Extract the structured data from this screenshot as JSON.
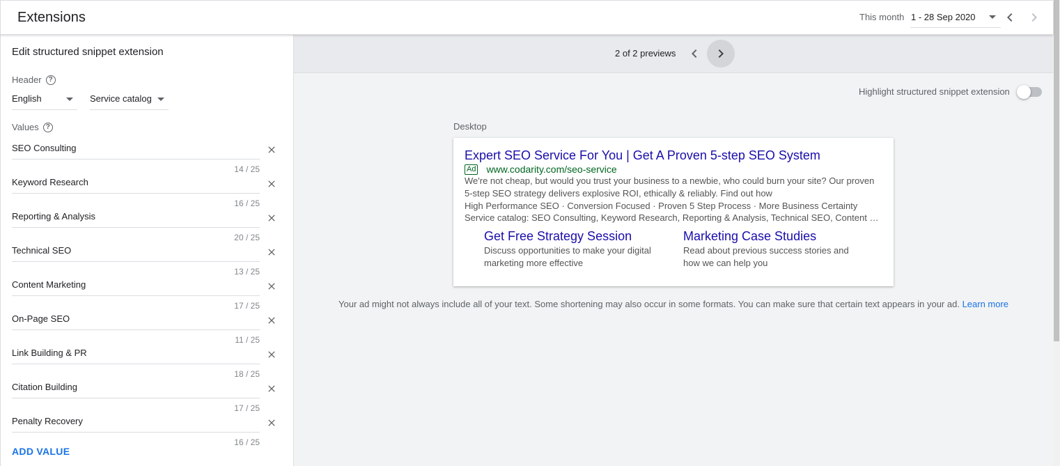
{
  "header": {
    "title": "Extensions",
    "range_label": "This month",
    "range_value": "1 - 28 Sep 2020"
  },
  "editor": {
    "heading": "Edit structured snippet extension",
    "header_label": "Header",
    "language": "English",
    "header_type": "Service catalog",
    "values_label": "Values",
    "values": [
      {
        "text": "SEO Consulting",
        "count": "14 / 25"
      },
      {
        "text": "Keyword Research",
        "count": "16 / 25"
      },
      {
        "text": "Reporting & Analysis",
        "count": "20 / 25"
      },
      {
        "text": "Technical SEO",
        "count": "13 / 25"
      },
      {
        "text": "Content Marketing",
        "count": "17 / 25"
      },
      {
        "text": "On-Page SEO",
        "count": "11 / 25"
      },
      {
        "text": "Link Building & PR",
        "count": "18 / 25"
      },
      {
        "text": "Citation Building",
        "count": "17 / 25"
      },
      {
        "text": "Penalty Recovery",
        "count": "16 / 25"
      }
    ],
    "add_value": "ADD VALUE"
  },
  "preview": {
    "count": "2 of 2 previews",
    "highlight_label": "Highlight structured snippet extension",
    "highlight_on": false,
    "device_label": "Desktop",
    "ad": {
      "headline": "Expert SEO Service For You | Get A Proven 5-step SEO System",
      "badge": "Ad",
      "url": "www.codarity.com/seo-service",
      "description": "We're not cheap, but would you trust your business to a newbie, who could burn your site? Our proven 5-step SEO strategy delivers explosive ROI, ethically & reliably. Find out how",
      "callouts": "High Performance SEO · Conversion Focused · Proven 5 Step Process · More Business Certainty",
      "snippet": "Service catalog: SEO Consulting, Keyword Research, Reporting & Analysis, Technical SEO, Content Marketing",
      "sitelinks": [
        {
          "title": "Get Free Strategy Session",
          "desc": "Discuss opportunities to make your digital marketing more effective"
        },
        {
          "title": "Marketing Case Studies",
          "desc": "Read about previous success stories and how we can help you"
        }
      ]
    },
    "note": "Your ad might not always include all of your text. Some shortening may also occur in some formats. You can make sure that certain text appears in your ad.",
    "learn_more": "Learn more"
  },
  "colors": {
    "accent": "#1a73e8",
    "ad_link": "#1a0dab",
    "ad_url": "#006621"
  }
}
